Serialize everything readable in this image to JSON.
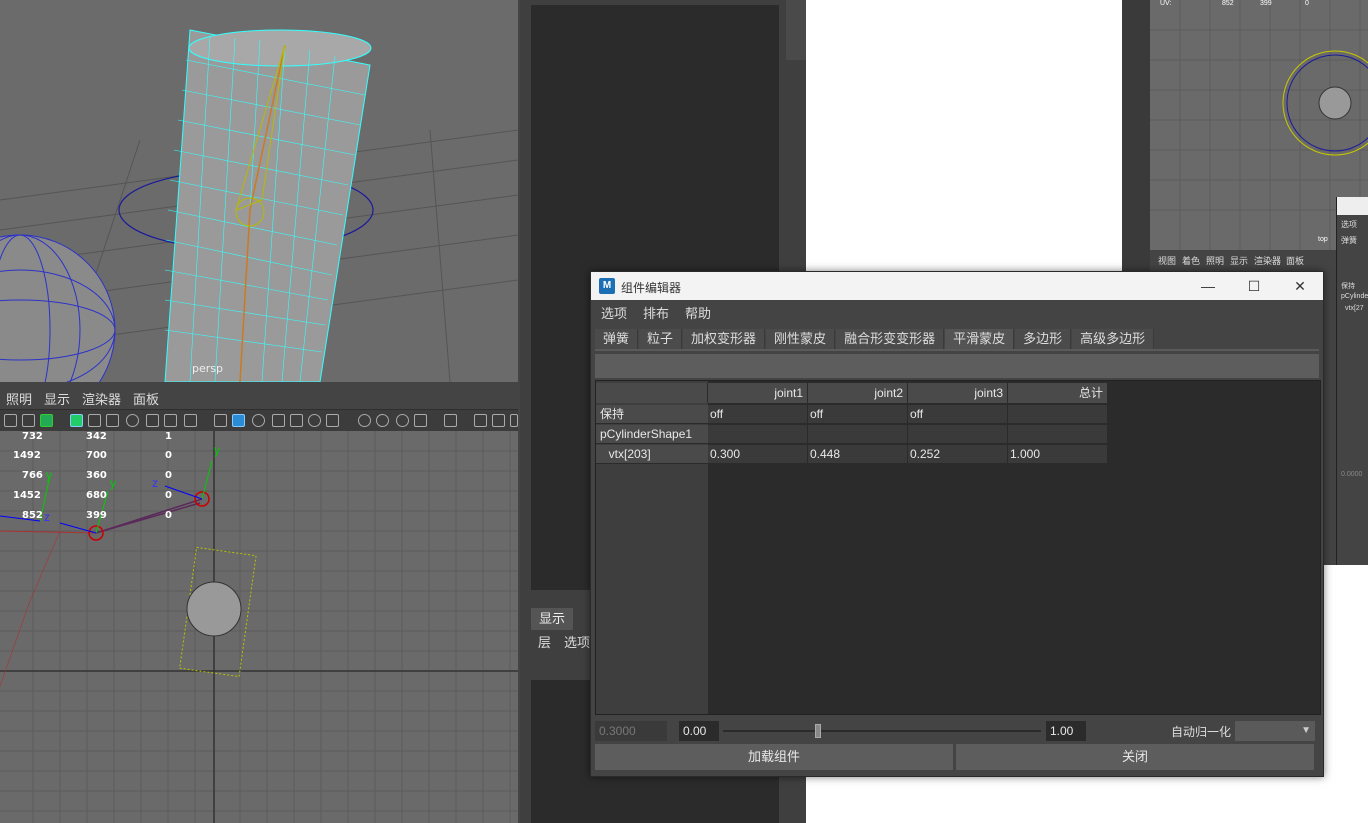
{
  "persp_view": {
    "label": "persp"
  },
  "viewport2": {
    "menu": [
      "照明",
      "显示",
      "渲染器",
      "面板"
    ],
    "hud": [
      [
        "732",
        "342",
        "1"
      ],
      [
        "1492",
        "700",
        "0"
      ],
      [
        "766",
        "360",
        "0"
      ],
      [
        "1452",
        "680",
        "0"
      ],
      [
        "852",
        "399",
        "0"
      ]
    ],
    "axis_labels": {
      "y1": "y",
      "z1": "z",
      "y2": "y",
      "z2": "z",
      "y3": "y"
    }
  },
  "mid_panel": {
    "tab_display": "显示",
    "row_items": [
      "层",
      "选项"
    ]
  },
  "right_panel": {
    "hud": [
      "UV:",
      "852",
      "399",
      "0"
    ],
    "menu": [
      "视图",
      "着色",
      "照明",
      "显示",
      "渲染器",
      "面板"
    ],
    "view_label": "top",
    "dialog_menu": [
      "选项"
    ],
    "dialog_tab": "弹簧",
    "dialog_rows": [
      "保持",
      "pCylinde",
      "vtx[27"
    ],
    "dialog_value": "0.0000"
  },
  "component_editor": {
    "title": "组件编辑器",
    "logo": "M",
    "window_controls": {
      "minimize": "—",
      "maximize": "☐",
      "close": "✕"
    },
    "menus": [
      "选项",
      "排布",
      "帮助"
    ],
    "tabs": [
      "弹簧",
      "粒子",
      "加权变形器",
      "刚性蒙皮",
      "融合形变变形器",
      "平滑蒙皮",
      "多边形",
      "高级多边形"
    ],
    "active_tab": "平滑蒙皮",
    "columns": [
      "joint1",
      "joint2",
      "joint3",
      "总计"
    ],
    "rows": [
      {
        "label": "保持",
        "values": [
          "off",
          "off",
          "off",
          ""
        ]
      },
      {
        "label": "pCylinderShape1",
        "values": [
          "",
          "",
          "",
          ""
        ]
      },
      {
        "label": "  vtx[203]",
        "values": [
          "0.300",
          "0.448",
          "0.252",
          "1.000"
        ]
      }
    ],
    "slider": {
      "current_value": "0.3000",
      "min": "0.00",
      "max": "1.00",
      "position": 0.3
    },
    "auto_normalize_label": "自动归一化",
    "load_button": "加载组件",
    "close_button": "关闭"
  }
}
